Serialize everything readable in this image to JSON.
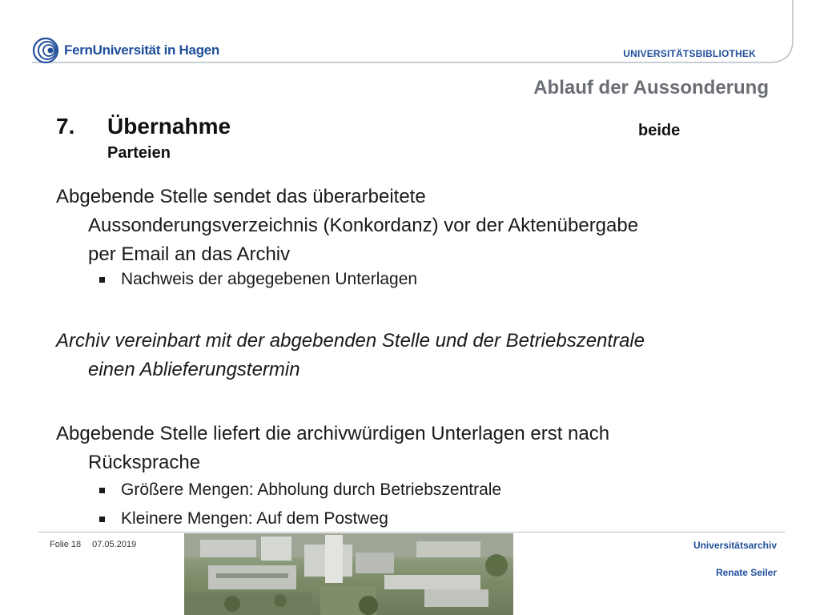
{
  "header": {
    "logo_text": "FernUniversität in Hagen",
    "unit_label": "UNIVERSITÄTSBIBLIOTHEK",
    "section_title": "Ablauf der Aussonderung"
  },
  "step": {
    "number": "7.",
    "title": "Übernahme",
    "right_label": "beide",
    "sub_label": "Parteien"
  },
  "content": {
    "p1_line1": "Abgebende Stelle sendet das überarbeitete",
    "p1_line2": "Aussonderungsverzeichnis (Konkordanz) vor der Aktenübergabe",
    "p1_line3": "per Email an das Archiv",
    "b1": "Nachweis der abgegebenen Unterlagen",
    "p2_line1": "Archiv vereinbart mit der abgebenden Stelle und der Betriebszentrale",
    "p2_line2": "einen Ablieferungstermin",
    "p3_line1": "Abgebende Stelle liefert die archivwürdigen Unterlagen erst nach",
    "p3_line2": "Rücksprache",
    "b2": "Größere Mengen: Abholung durch Betriebszentrale",
    "b3": "Kleinere Mengen: Auf dem Postweg"
  },
  "footer": {
    "slide_label": "Folie 18",
    "date": "07.05.2019",
    "department": "Universitätsarchiv",
    "author": "Renate Seiler"
  },
  "colors": {
    "brand_blue": "#1f4e9a",
    "title_grey": "#6b6f75"
  },
  "icons": {
    "logo": "fernuni-logo-icon",
    "bullet": "square-bullet-icon"
  }
}
